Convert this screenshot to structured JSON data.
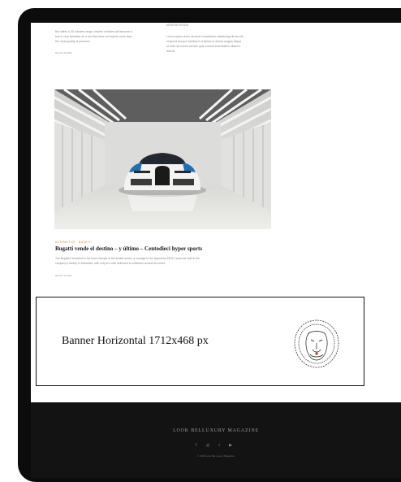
{
  "article_left_snippet": {
    "lines": [
      "But within a 30 minutes range, electric vehicles will become a",
      "test is very sensitive as a car that does not require more than",
      "the most quality of premium"
    ],
    "read_more": "READ MORE"
  },
  "article_right_snippet": {
    "heading": "MODERN DESIGN",
    "lines": [
      "Lorem ipsum dolor sit amet consectetur adipiscing elit sed do",
      "eiusmod tempor incididunt ut labore et dolore magna aliqua",
      "ut enim ad minim veniam quis nostrud exercitation ullamco",
      "laboris"
    ]
  },
  "featured_article": {
    "category": "AUTOMOTIVE · BUGATTI",
    "title": "Bugatti vende el destino – y último – Centodieci hyper sports",
    "excerpt_lines": [
      "The Bugatti Centodieci is the final example of the limited series, a homage to the legendary EB110 supercar built in the",
      "company's factory in Molsheim, with only ten units delivered to collectors around the world."
    ],
    "read_more": "READ MORE"
  },
  "banner": {
    "text": "Banner Horizontal 1712x468 px",
    "logo_icon": "lion-head-logo"
  },
  "footer": {
    "brand": "LOOK BELLUXURY MAGAZINE",
    "social_icons": [
      "facebook-icon",
      "instagram-icon",
      "twitter-icon",
      "youtube-icon"
    ],
    "social_glyphs": [
      "f",
      "◎",
      "t",
      "▶"
    ],
    "copyright": "© 2023 Look Bel Luxury Magazine"
  }
}
